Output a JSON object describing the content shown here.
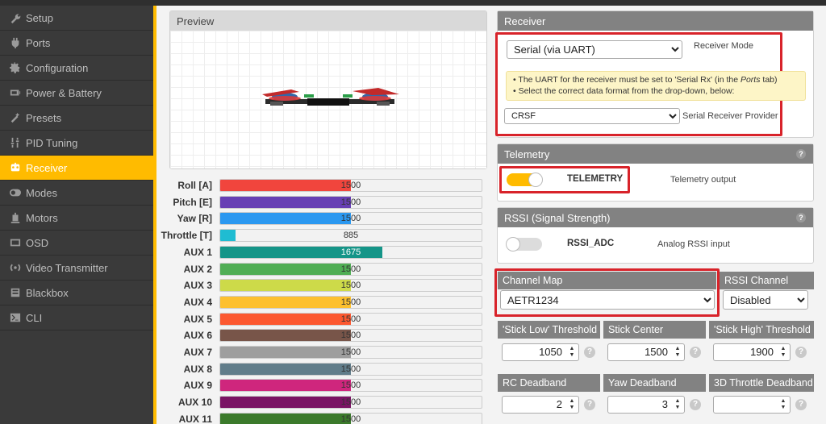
{
  "sidebar": {
    "items": [
      {
        "label": "Setup",
        "icon": "wrench-icon"
      },
      {
        "label": "Ports",
        "icon": "plug-icon"
      },
      {
        "label": "Configuration",
        "icon": "gear-icon"
      },
      {
        "label": "Power & Battery",
        "icon": "battery-icon"
      },
      {
        "label": "Presets",
        "icon": "wand-icon"
      },
      {
        "label": "PID Tuning",
        "icon": "sliders-icon"
      },
      {
        "label": "Receiver",
        "icon": "robot-icon",
        "active": true
      },
      {
        "label": "Modes",
        "icon": "toggle-icon"
      },
      {
        "label": "Motors",
        "icon": "motor-icon"
      },
      {
        "label": "OSD",
        "icon": "osd-icon"
      },
      {
        "label": "Video Transmitter",
        "icon": "broadcast-icon"
      },
      {
        "label": "Blackbox",
        "icon": "blackbox-icon"
      },
      {
        "label": "CLI",
        "icon": "terminal-icon"
      }
    ],
    "accent": "#ffbb00"
  },
  "preview": {
    "title": "Preview"
  },
  "channels": [
    {
      "label": "Roll [A]",
      "value": "1500",
      "fraction": 0.5,
      "color": "#f1453d"
    },
    {
      "label": "Pitch [E]",
      "value": "1500",
      "fraction": 0.5,
      "color": "#673fb4"
    },
    {
      "label": "Yaw [R]",
      "value": "1500",
      "fraction": 0.5,
      "color": "#2b98f0"
    },
    {
      "label": "Throttle [T]",
      "value": "885",
      "fraction": 0.06,
      "color": "#1fbcd2"
    },
    {
      "label": "AUX 1",
      "value": "1675",
      "fraction": 0.62,
      "color": "#159588"
    },
    {
      "label": "AUX 2",
      "value": "1500",
      "fraction": 0.5,
      "color": "#50ae55"
    },
    {
      "label": "AUX 3",
      "value": "1500",
      "fraction": 0.5,
      "color": "#cdda49"
    },
    {
      "label": "AUX 4",
      "value": "1500",
      "fraction": 0.5,
      "color": "#fdc02f"
    },
    {
      "label": "AUX 5",
      "value": "1500",
      "fraction": 0.5,
      "color": "#fc5830"
    },
    {
      "label": "AUX 6",
      "value": "1500",
      "fraction": 0.5,
      "color": "#785549"
    },
    {
      "label": "AUX 7",
      "value": "1500",
      "fraction": 0.5,
      "color": "#9e9e9e"
    },
    {
      "label": "AUX 8",
      "value": "1500",
      "fraction": 0.5,
      "color": "#617d8a"
    },
    {
      "label": "AUX 9",
      "value": "1500",
      "fraction": 0.5,
      "color": "#cf267d"
    },
    {
      "label": "AUX 10",
      "value": "1500",
      "fraction": 0.5,
      "color": "#7a1464"
    },
    {
      "label": "AUX 11",
      "value": "1500",
      "fraction": 0.5,
      "color": "#3b7a2b"
    }
  ],
  "receiver": {
    "title": "Receiver",
    "mode_value": "Serial (via UART)",
    "mode_label": "Receiver Mode",
    "hint_line1_pre": "• The UART for the receiver must be set to 'Serial Rx' (in the ",
    "hint_line1_em": "Ports",
    "hint_line1_post": " tab)",
    "hint_line2": "• Select the correct data format from the drop-down, below:",
    "provider_value": "CRSF",
    "provider_label": "Serial Receiver Provider"
  },
  "telemetry": {
    "title": "Telemetry",
    "toggle_label": "TELEMETRY",
    "desc": "Telemetry output",
    "enabled": true
  },
  "rssi": {
    "title": "RSSI (Signal Strength)",
    "toggle_label": "RSSI_ADC",
    "desc": "Analog RSSI input",
    "enabled": false
  },
  "channel_map": {
    "title": "Channel Map",
    "value": "AETR1234"
  },
  "rssi_channel": {
    "title": "RSSI Channel",
    "value": "Disabled"
  },
  "thresholds": [
    {
      "label": "'Stick Low' Threshold",
      "value": "1050"
    },
    {
      "label": "Stick Center",
      "value": "1500"
    },
    {
      "label": "'Stick High' Threshold",
      "value": "1900"
    }
  ],
  "deadbands": [
    {
      "label": "RC Deadband",
      "value": "2"
    },
    {
      "label": "Yaw Deadband",
      "value": "3"
    },
    {
      "label": "3D Throttle Deadband",
      "value": ""
    }
  ],
  "help_glyph": "?"
}
